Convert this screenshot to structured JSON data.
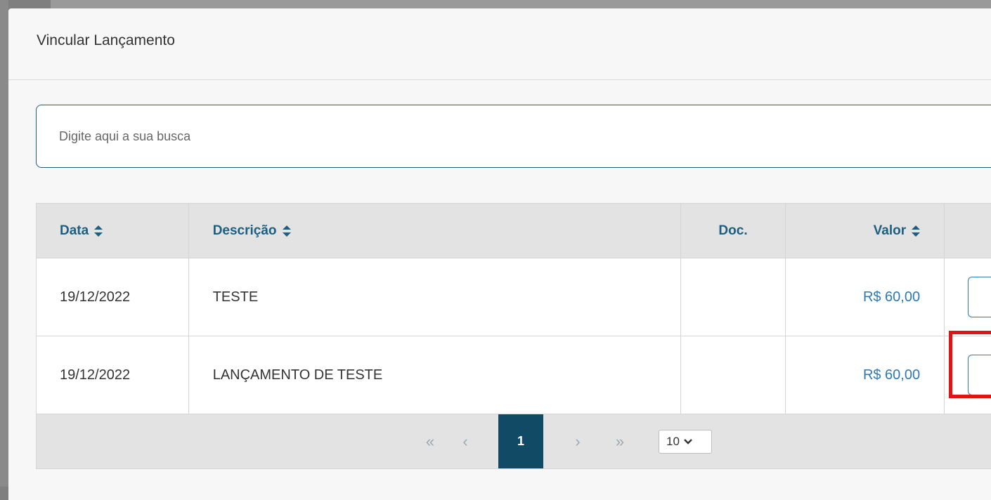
{
  "modal": {
    "title": "Vincular Lançamento"
  },
  "search": {
    "placeholder": "Digite aqui a sua busca",
    "value": ""
  },
  "table": {
    "columns": [
      {
        "label": "Data",
        "sortable": true
      },
      {
        "label": "Descrição",
        "sortable": true
      },
      {
        "label": "Doc.",
        "sortable": false
      },
      {
        "label": "Valor",
        "sortable": true
      },
      {
        "label": "",
        "sortable": false
      }
    ],
    "rows": [
      {
        "data": "19/12/2022",
        "descricao": "TESTE",
        "doc": "",
        "valor": "R$ 60,00"
      },
      {
        "data": "19/12/2022",
        "descricao": "LANÇAMENTO DE TESTE",
        "doc": "",
        "valor": "R$ 60,00"
      }
    ]
  },
  "pagination": {
    "first_icon": "«",
    "prev_icon": "‹",
    "current_page": "1",
    "next_icon": "›",
    "last_icon": "»",
    "page_size": "10"
  },
  "colors": {
    "accent": "#1d5f80",
    "value_link": "#2d79b5",
    "active_page": "#114a64",
    "highlight": "#e01414"
  }
}
